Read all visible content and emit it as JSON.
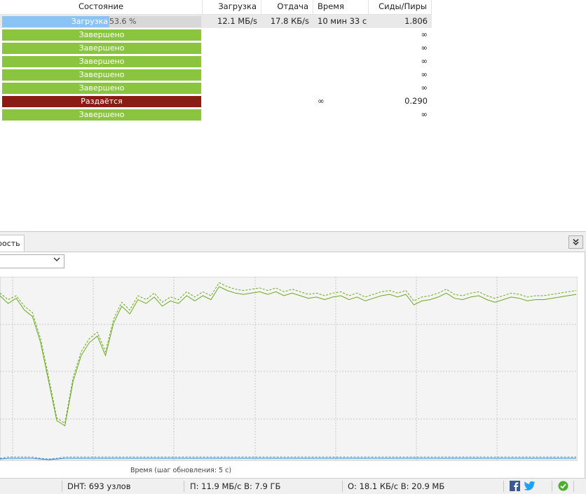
{
  "columns": {
    "status": "Состояние",
    "download": "Загрузка",
    "upload": "Отдача",
    "time": "Время",
    "seeds_peers": "Сиды/Пиры"
  },
  "rows": [
    {
      "status": "Загрузка",
      "percent": "53.6 %",
      "progress": 0.536,
      "kind": "dl",
      "download": "12.1 МБ/s",
      "upload": "17.8 КБ/s",
      "time": "10 мин 33 с",
      "seeds": "1.806"
    },
    {
      "status": "Завершено",
      "kind": "done",
      "download": "",
      "upload": "",
      "time": "",
      "seeds": "∞"
    },
    {
      "status": "Завершено",
      "kind": "done",
      "download": "",
      "upload": "",
      "time": "",
      "seeds": "∞"
    },
    {
      "status": "Завершено",
      "kind": "done",
      "download": "",
      "upload": "",
      "time": "",
      "seeds": "∞"
    },
    {
      "status": "Завершено",
      "kind": "done",
      "download": "",
      "upload": "",
      "time": "",
      "seeds": "∞"
    },
    {
      "status": "Завершено",
      "kind": "done",
      "download": "",
      "upload": "",
      "time": "",
      "seeds": "∞"
    },
    {
      "status": "Раздаётся",
      "kind": "seed",
      "download": "",
      "upload": "",
      "time": "∞",
      "seeds": "0.290"
    },
    {
      "status": "Завершено",
      "kind": "done",
      "download": "",
      "upload": "",
      "time": "",
      "seeds": "∞"
    }
  ],
  "panel": {
    "tab_label": "рость",
    "collapse_icon": "double-chevron-down-icon",
    "combo_icon": "chevron-down-icon",
    "x_axis_label": "Время (шаг обновления: 5 с)"
  },
  "colors": {
    "done": "#8bc540",
    "seeding": "#8b1b15",
    "downloading": "#8cc3f5",
    "graph_download": "#6aaa1e",
    "graph_upload": "#3a8ec8"
  },
  "chart_data": {
    "type": "line",
    "xlabel": "Время (шаг обновления: 5 с)",
    "ylabel": "",
    "ylim": [
      0,
      14
    ],
    "series": [
      {
        "values": [
          12.6,
          12.0,
          12.4,
          11.5,
          11.0,
          9.0,
          6.0,
          3.0,
          2.6,
          6.0,
          8.0,
          9.0,
          9.5,
          8.0,
          10.5,
          11.8,
          11.2,
          12.3,
          12.0,
          12.5,
          11.8,
          12.2,
          12.0,
          12.6,
          12.2,
          12.6,
          12.3,
          13.3,
          13.0,
          12.8,
          12.7,
          12.8,
          12.9,
          12.7,
          12.9,
          12.6,
          12.8,
          12.6,
          12.4,
          12.5,
          12.3,
          12.5,
          12.6,
          12.3,
          12.5,
          12.2,
          12.4,
          12.6,
          12.7,
          12.5,
          12.7,
          11.9,
          12.2,
          12.3,
          12.5,
          12.8,
          12.4,
          12.3,
          12.5,
          12.6,
          12.3,
          12.1,
          12.3,
          12.5,
          12.4,
          12.2,
          12.3,
          12.3,
          12.4,
          12.5,
          12.6,
          12.7
        ]
      },
      {
        "values": [
          12.8,
          12.3,
          12.6,
          11.8,
          11.3,
          9.3,
          6.3,
          3.2,
          2.8,
          6.3,
          8.3,
          9.3,
          9.8,
          8.3,
          10.8,
          12.1,
          11.5,
          12.6,
          12.3,
          12.8,
          12.1,
          12.5,
          12.3,
          12.9,
          12.5,
          12.9,
          12.6,
          13.6,
          13.3,
          13.1,
          13.0,
          13.1,
          13.2,
          13.0,
          13.2,
          12.9,
          13.1,
          12.9,
          12.7,
          12.8,
          12.6,
          12.8,
          12.9,
          12.6,
          12.8,
          12.5,
          12.7,
          12.9,
          13.0,
          12.8,
          13.0,
          12.2,
          12.5,
          12.6,
          12.8,
          13.1,
          12.7,
          12.6,
          12.8,
          12.9,
          12.6,
          12.4,
          12.6,
          12.8,
          12.7,
          12.5,
          12.6,
          12.6,
          12.7,
          12.8,
          12.9,
          13.0
        ]
      },
      {
        "values": [
          0.05,
          0.1,
          0.1,
          0.1,
          0.1,
          0.05,
          0.0,
          0.05,
          0.1,
          0.1,
          0.1,
          0.1,
          0.1,
          0.1,
          0.1,
          0.1,
          0.1,
          0.1,
          0.1,
          0.1,
          0.1,
          0.1,
          0.1,
          0.1,
          0.1,
          0.1,
          0.1,
          0.1,
          0.1,
          0.1,
          0.1,
          0.1,
          0.1,
          0.1,
          0.1,
          0.1,
          0.1,
          0.1,
          0.1,
          0.1,
          0.1,
          0.1,
          0.1,
          0.1,
          0.1,
          0.1,
          0.1,
          0.1,
          0.1,
          0.1,
          0.1,
          0.1,
          0.1,
          0.1,
          0.1,
          0.1,
          0.1,
          0.1,
          0.1,
          0.1,
          0.1,
          0.1,
          0.1,
          0.1,
          0.1,
          0.1,
          0.1,
          0.1,
          0.1,
          0.1,
          0.1,
          0.1
        ]
      },
      {
        "values": [
          0.1,
          0.2,
          0.2,
          0.2,
          0.2,
          0.1,
          0.05,
          0.1,
          0.2,
          0.2,
          0.2,
          0.2,
          0.2,
          0.2,
          0.2,
          0.2,
          0.2,
          0.2,
          0.2,
          0.2,
          0.2,
          0.2,
          0.2,
          0.2,
          0.2,
          0.2,
          0.2,
          0.2,
          0.2,
          0.2,
          0.2,
          0.2,
          0.2,
          0.2,
          0.2,
          0.2,
          0.2,
          0.2,
          0.2,
          0.2,
          0.2,
          0.2,
          0.2,
          0.2,
          0.2,
          0.2,
          0.2,
          0.2,
          0.2,
          0.2,
          0.2,
          0.2,
          0.2,
          0.2,
          0.2,
          0.2,
          0.2,
          0.2,
          0.2,
          0.2,
          0.2,
          0.2,
          0.2,
          0.2,
          0.2,
          0.2,
          0.2,
          0.2,
          0.2,
          0.2,
          0.2,
          0.2
        ]
      }
    ]
  },
  "statusbar": {
    "dht": "DHT: 693 узлов",
    "down": "П: 11.9 МБ/с В: 7.9 ГБ",
    "up": "О: 18.1 КБ/с В: 20.9 МБ",
    "icons": [
      "facebook-icon",
      "twitter-icon",
      "connection-ok-icon"
    ]
  }
}
